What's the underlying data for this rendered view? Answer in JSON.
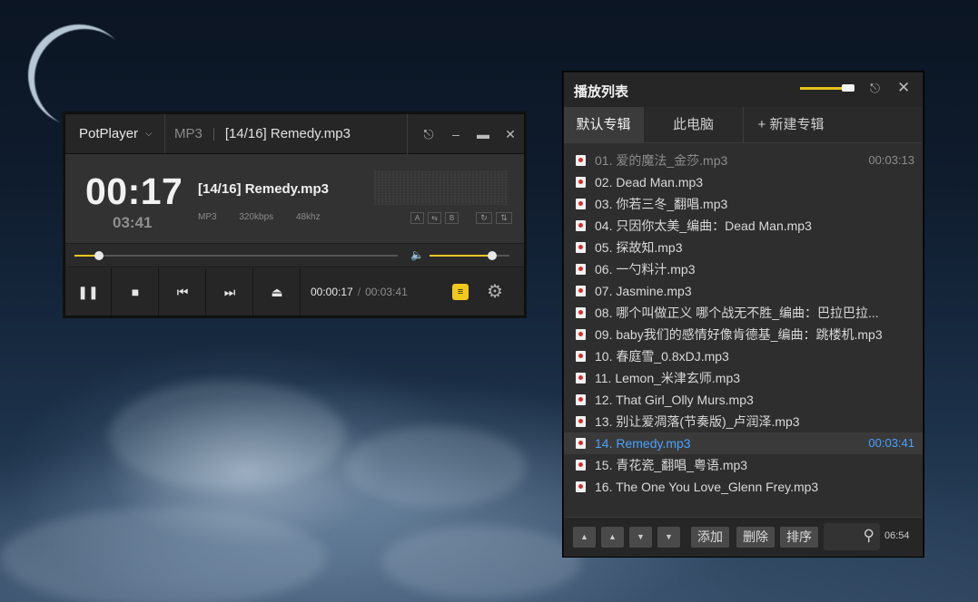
{
  "player": {
    "brand": "PotPlayer",
    "format": "MP3",
    "title": "[14/16] Remedy.mp3",
    "big_time": "00:17",
    "sub_time": "03:41",
    "info_title": "[14/16] Remedy.mp3",
    "meta": {
      "format": "MP3",
      "bitrate": "320kbps",
      "samplerate": "48khz"
    },
    "current_time": "00:00:17",
    "total_time": "00:03:41",
    "seek_progress": 0.077,
    "volume": 0.78
  },
  "playlist": {
    "title": "播放列表",
    "tabs": [
      "默认专辑",
      "此电脑",
      "+ 新建专辑"
    ],
    "items": [
      {
        "title": "01. 爱的魔法_金莎.mp3",
        "duration": "00:03:13",
        "state": "played"
      },
      {
        "title": "02. Dead Man.mp3",
        "duration": "",
        "state": "normal"
      },
      {
        "title": "03. 你若三冬_翻唱.mp3",
        "duration": "",
        "state": "normal"
      },
      {
        "title": "04. 只因你太美_编曲：Dead Man.mp3",
        "duration": "",
        "state": "normal"
      },
      {
        "title": "05. 探故知.mp3",
        "duration": "",
        "state": "normal"
      },
      {
        "title": "06. 一勺料汁.mp3",
        "duration": "",
        "state": "normal"
      },
      {
        "title": "07. Jasmine.mp3",
        "duration": "",
        "state": "normal"
      },
      {
        "title": "08. 哪个叫做正义 哪个战无不胜_编曲：巴拉巴拉...",
        "duration": "",
        "state": "normal"
      },
      {
        "title": "09. baby我们的感情好像肯德基_编曲：跳楼机.mp3",
        "duration": "",
        "state": "normal"
      },
      {
        "title": "10. 春庭雪_0.8xDJ.mp3",
        "duration": "",
        "state": "normal"
      },
      {
        "title": "11. Lemon_米津玄师.mp3",
        "duration": "",
        "state": "normal"
      },
      {
        "title": "12. That Girl_Olly Murs.mp3",
        "duration": "",
        "state": "normal"
      },
      {
        "title": "13. 别让爱凋落(节奏版)_卢润泽.mp3",
        "duration": "",
        "state": "normal"
      },
      {
        "title": "14. Remedy.mp3",
        "duration": "00:03:41",
        "state": "current"
      },
      {
        "title": "15. 青花瓷_翻唱_粤语.mp3",
        "duration": "",
        "state": "normal"
      },
      {
        "title": "16. The One You Love_Glenn Frey.mp3",
        "duration": "",
        "state": "normal"
      }
    ],
    "footer": {
      "add": "添加",
      "delete": "删除",
      "sort": "排序",
      "total_time": "06:54"
    }
  },
  "colors": {
    "accent": "#f0c81e",
    "current_track": "#4aa0ff"
  }
}
